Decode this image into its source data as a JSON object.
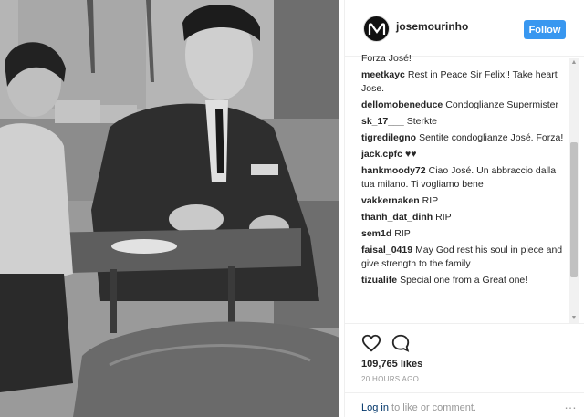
{
  "header": {
    "username": "josemourinho",
    "follow_label": "Follow"
  },
  "comments": [
    {
      "author": "",
      "text": "Forza José!"
    },
    {
      "author": "meetkayc",
      "text": "Rest in Peace Sir Felix!! Take heart Jose."
    },
    {
      "author": "dellomobeneduce",
      "text": "Condoglianze Supermister"
    },
    {
      "author": "sk_17___",
      "text": "Sterkte"
    },
    {
      "author": "tigredilegno",
      "text": "Sentite condoglianze José. Forza!"
    },
    {
      "author": "jack.cpfc",
      "text": "♥♥"
    },
    {
      "author": "hankmoody72",
      "text": "Ciao José. Un abbraccio dalla tua milano. Ti vogliamo bene"
    },
    {
      "author": "vakkernaken",
      "text": "RIP"
    },
    {
      "author": "thanh_dat_dinh",
      "text": "RIP"
    },
    {
      "author": "sem1d",
      "text": "RIP"
    },
    {
      "author": "faisal_0419",
      "text": "May God rest his soul in piece and give strength to the family"
    },
    {
      "author": "tizualife",
      "text": "Special one from a Great one!"
    }
  ],
  "actions": {
    "likes": "109,765 likes",
    "timestamp": "20 HOURS AGO"
  },
  "footer": {
    "login_link": "Log in",
    "login_rest": "to like or comment.",
    "more_glyph": "…"
  },
  "icons": {
    "heart": "heart-icon",
    "comment": "comment-bubble-icon",
    "avatar_logo": "m-logo-icon"
  }
}
